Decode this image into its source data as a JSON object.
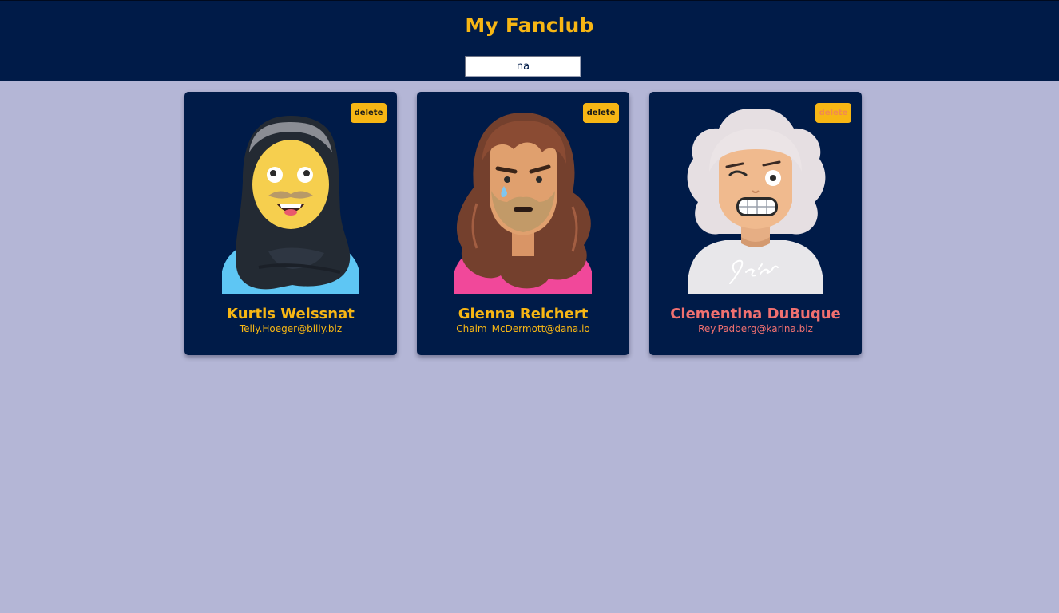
{
  "header": {
    "title": "My Fanclub",
    "search_value": "na"
  },
  "cards": [
    {
      "name": "Kurtis Weissnat",
      "email": "Telly.Hoeger@billy.biz",
      "delete_label": "delete",
      "avatar": "avatar-hijab-woman-illustration"
    },
    {
      "name": "Glenna Reichert",
      "email": "Chaim_McDermott@dana.io",
      "delete_label": "delete",
      "avatar": "avatar-long-hair-crying-illustration"
    },
    {
      "name": "Clementina DuBuque",
      "email": "Rey.Padberg@karina.biz",
      "delete_label": "delete",
      "avatar": "avatar-white-hair-selena-illustration"
    }
  ],
  "colors": {
    "header_bg": "#001b48",
    "page_bg": "#b4b6d6",
    "accent": "#f7b614",
    "highlight_text": "#f07070"
  }
}
